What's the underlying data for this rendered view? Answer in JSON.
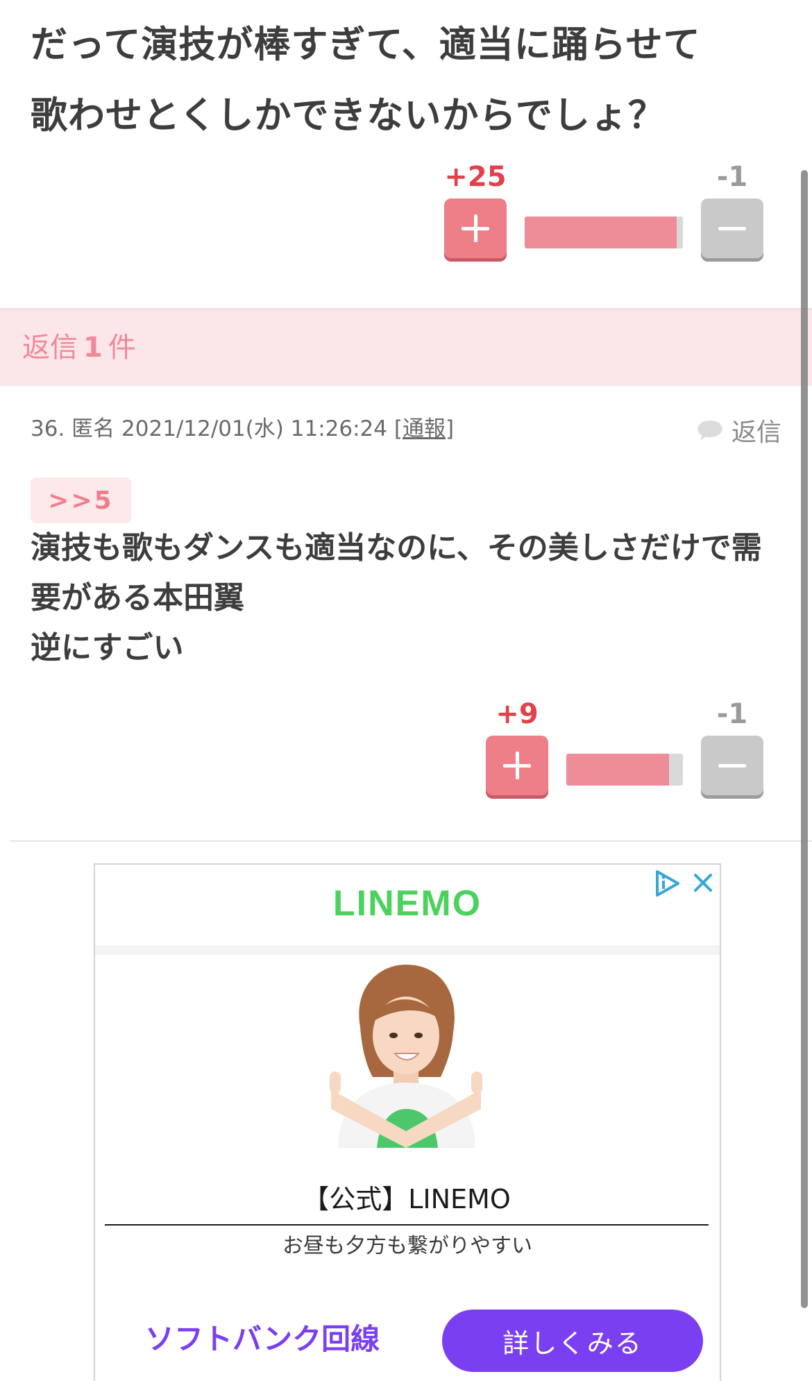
{
  "top_comment": {
    "body_lines": [
      "だって演技が棒すぎて、適当に踊らせて",
      "歌わせとくしかできないからでしょ？"
    ],
    "vote": {
      "plus_count": "+25",
      "minus_count": "-1",
      "plus_ratio": 0.96
    }
  },
  "reply_banner": {
    "prefix": "返信",
    "count": "1",
    "suffix": "件"
  },
  "reply_comment": {
    "number": "36.",
    "author": "匿名",
    "timestamp": "2021/12/01(水) 11:26:24",
    "report_open": "[",
    "report_label": "通報",
    "report_close": "]",
    "reply_label": "返信",
    "anchor": ">>5",
    "body_lines": [
      "演技も歌もダンスも適当なのに、その美しさだけで需",
      "要がある本田翼",
      "逆にすごい"
    ],
    "vote": {
      "plus_count": "+9",
      "minus_count": "-1",
      "plus_ratio": 0.88
    }
  },
  "ad": {
    "brand_logo_text": "LINEMO",
    "title": "【公式】LINEMO",
    "subtitle": "お昼も夕方も繋がりやすい",
    "advertiser": "ソフトバンク回線",
    "cta_label": "詳しくみる",
    "icons": [
      "ad-choices-icon",
      "close-icon"
    ]
  },
  "colors": {
    "plus_accent": "#e0424b",
    "plus_button": "#ee7f89",
    "minus_button": "#c9c9c9",
    "reply_banner_bg": "#fbe6ea",
    "brand_green": "#4cd15c",
    "cta_purple": "#7b3ff2"
  }
}
